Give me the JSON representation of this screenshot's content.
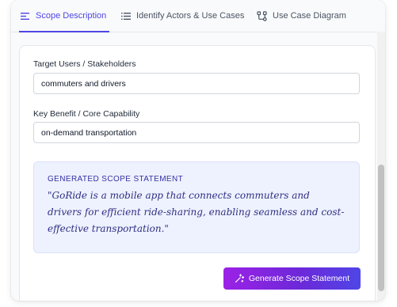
{
  "tabs": [
    {
      "label": "Scope Description",
      "icon": "align-left-icon",
      "active": true
    },
    {
      "label": "Identify Actors & Use Cases",
      "icon": "list-icon",
      "active": false
    },
    {
      "label": "Use Case Diagram",
      "icon": "diagram-icon",
      "active": false
    }
  ],
  "form": {
    "target_users": {
      "label": "Target Users / Stakeholders",
      "value": "commuters and drivers"
    },
    "key_benefit": {
      "label": "Key Benefit / Core Capability",
      "value": "on-demand transportation"
    }
  },
  "scope": {
    "title": "GENERATED SCOPE STATEMENT",
    "statement": "\"GoRide is a mobile app that connects commuters and drivers for efficient ride-sharing, enabling seamless and cost-effective transportation.\""
  },
  "generate_button": {
    "label": "Generate Scope Statement",
    "icon": "magic-wand-icon"
  },
  "colors": {
    "accent": "#4f46e5",
    "scope_bg": "#eef2ff",
    "scope_text": "#312e81",
    "button_gradient_start": "#9b22e6",
    "button_gradient_end": "#4f46e5"
  }
}
